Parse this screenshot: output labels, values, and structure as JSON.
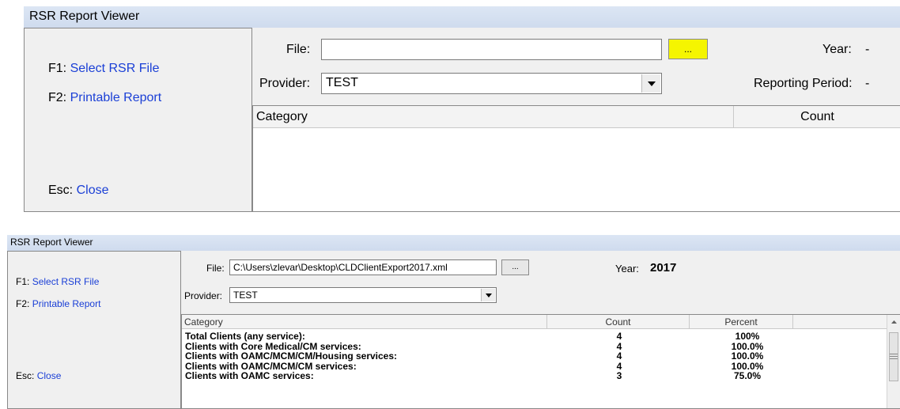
{
  "panel1": {
    "title": "RSR Report Viewer",
    "sidebar": {
      "f1_key": "F1:",
      "f1_label": "Select RSR File",
      "f2_key": "F2:",
      "f2_label": "Printable Report",
      "esc_key": "Esc:",
      "esc_label": "Close"
    },
    "file_label": "File:",
    "file_value": "",
    "browse_label": "...",
    "year_label": "Year:",
    "year_value": "-",
    "provider_label": "Provider:",
    "provider_value": "TEST",
    "reporting_period_label": "Reporting Period:",
    "reporting_period_value": "-",
    "grid": {
      "columns": [
        "Category",
        "Count"
      ]
    },
    "colors": {
      "browse_highlight": "#f5f500",
      "link": "#1a3fd6"
    }
  },
  "panel2": {
    "title": "RSR Report Viewer",
    "sidebar": {
      "f1_key": "F1:",
      "f1_label": "Select RSR File",
      "f2_key": "F2:",
      "f2_label": "Printable Report",
      "esc_key": "Esc:",
      "esc_label": "Close"
    },
    "file_label": "File:",
    "file_value": "C:\\Users\\zlevar\\Desktop\\CLDClientExport2017.xml",
    "browse_label": "...",
    "year_label": "Year:",
    "year_value": "2017",
    "provider_label": "Provider:",
    "provider_value": "TEST",
    "grid": {
      "columns": [
        "Category",
        "Count",
        "Percent"
      ],
      "rows": [
        {
          "category": "Total Clients (any service):",
          "count": "4",
          "percent": "100%"
        },
        {
          "category": "Clients with Core Medical/CM services:",
          "count": "4",
          "percent": "100.0%"
        },
        {
          "category": "Clients with OAMC/MCM/CM/Housing services:",
          "count": "4",
          "percent": "100.0%"
        },
        {
          "category": "Clients with OAMC/MCM/CM services:",
          "count": "4",
          "percent": "100.0%"
        },
        {
          "category": "Clients with OAMC services:",
          "count": "3",
          "percent": "75.0%"
        }
      ]
    }
  },
  "icons": {
    "combo_arrow": "chevron-down-icon",
    "scroll_up": "scroll-up-arrow-icon",
    "scroll_grip": "scroll-grip-icon"
  }
}
